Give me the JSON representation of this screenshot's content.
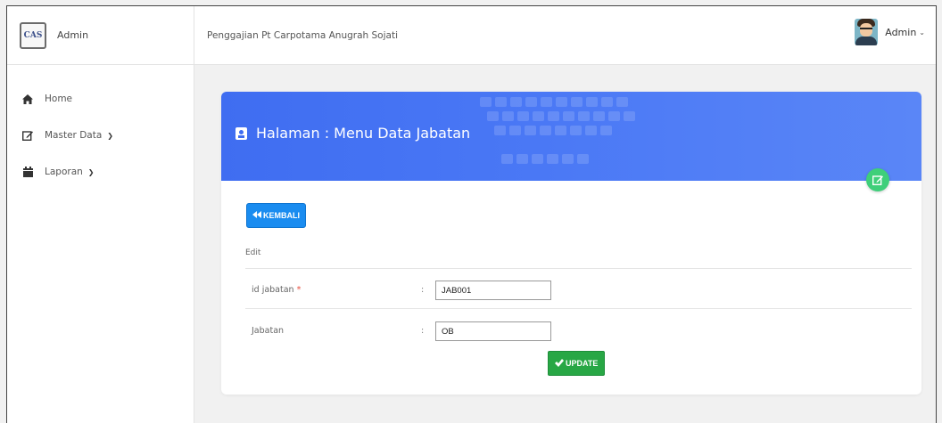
{
  "brand": {
    "logo_text": "CAS",
    "name": "Admin"
  },
  "header": {
    "title": "Penggajian Pt Carpotama Anugrah Sojati"
  },
  "user": {
    "name": "Admin",
    "caret_icon": "chevron-down-icon"
  },
  "sidebar": {
    "items": [
      {
        "label": "Home",
        "icon": "home-icon"
      },
      {
        "label": "Master Data",
        "icon": "edit-icon",
        "caret": "chevron-down-icon"
      },
      {
        "label": "Laporan",
        "icon": "calendar-icon",
        "caret": "chevron-down-icon"
      }
    ]
  },
  "card": {
    "title": "Halaman : Menu Data Jabatan",
    "header_color": "#4070f4",
    "fab_color": "#3fcf7a",
    "back_button": "KEMBALI",
    "section_label": "Edit",
    "fields": [
      {
        "label": "id jabatan",
        "required": "*",
        "colon": ":",
        "value": "JAB001"
      },
      {
        "label": "Jabatan",
        "colon": ":",
        "value": "OB"
      }
    ],
    "update_button": "UPDATE"
  }
}
